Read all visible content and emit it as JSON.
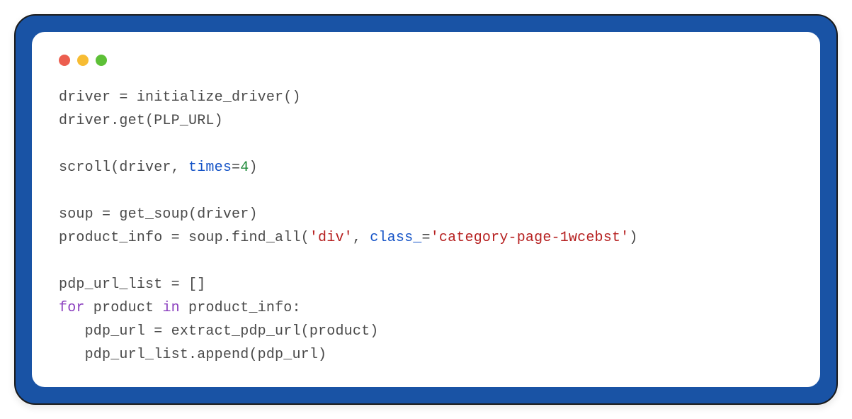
{
  "code": {
    "line1": {
      "a": "driver = initialize_driver()"
    },
    "line2": {
      "a": "driver.get(PLP_URL)"
    },
    "line3": {
      "a": ""
    },
    "line4": {
      "a": "scroll(driver, ",
      "b": "times",
      "c": "=",
      "d": "4",
      "e": ")"
    },
    "line5": {
      "a": ""
    },
    "line6": {
      "a": "soup = get_soup(driver)"
    },
    "line7": {
      "a": "product_info = soup.find_all(",
      "b": "'div'",
      "c": ", ",
      "d": "class_",
      "e": "=",
      "f": "'category-page-1wcebst'",
      "g": ")"
    },
    "line8": {
      "a": ""
    },
    "line9": {
      "a": "pdp_url_list = []"
    },
    "line10": {
      "a": "for",
      "b": " product ",
      "c": "in",
      "d": " product_info:"
    },
    "line11": {
      "a": "   pdp_url = extract_pdp_url(product)"
    },
    "line12": {
      "a": "   pdp_url_list.append(pdp_url)"
    }
  }
}
